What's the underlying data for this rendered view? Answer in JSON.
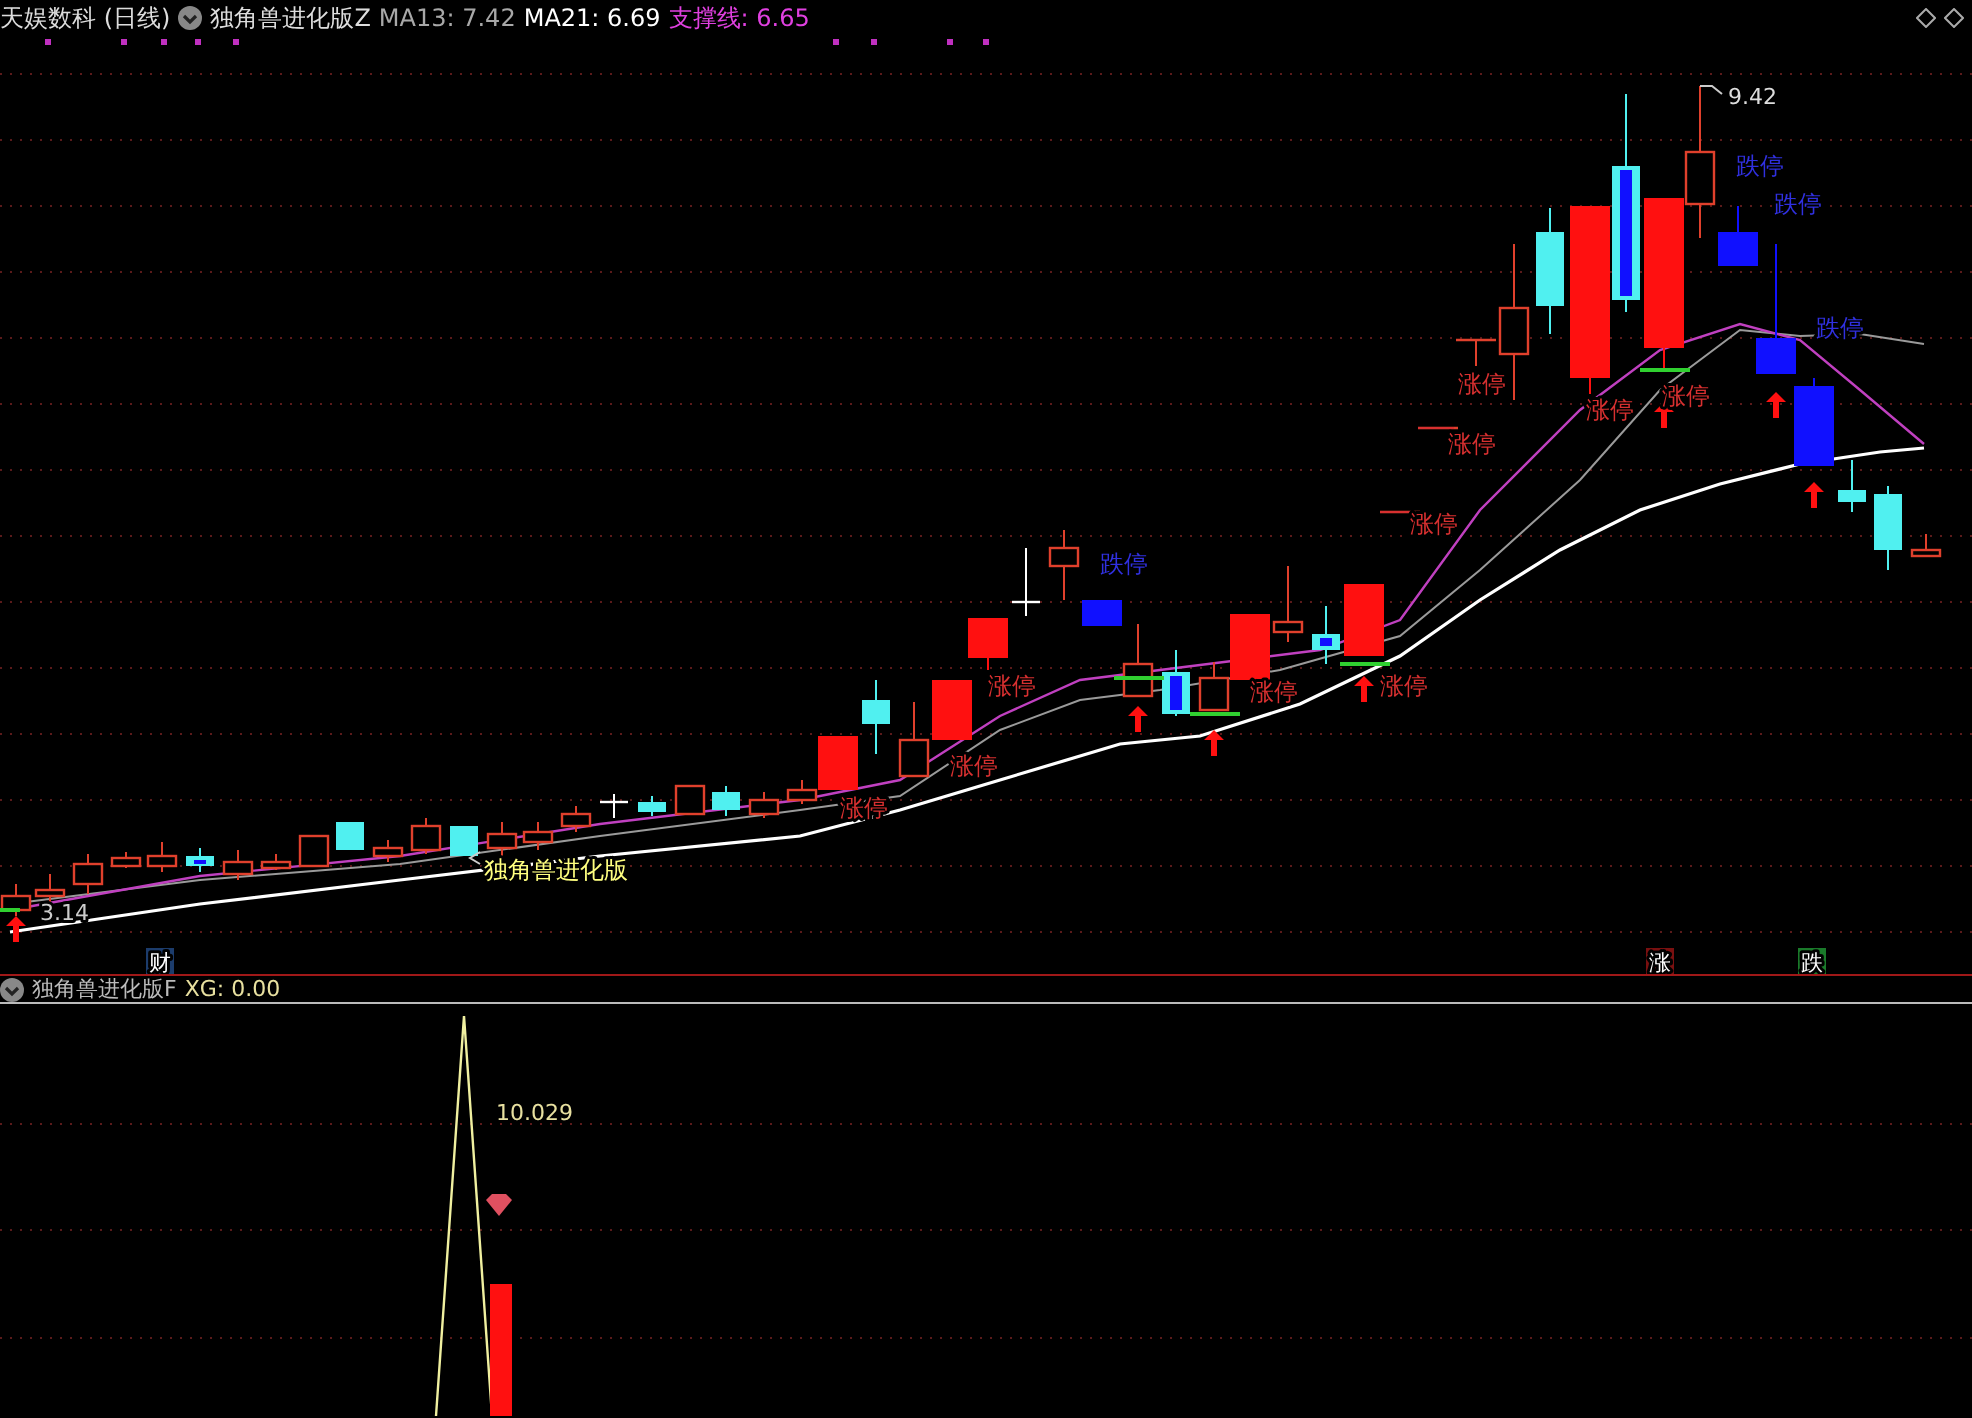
{
  "header": {
    "stock": "天娱数科 (日线)",
    "indicator": "独角兽进化版Z",
    "readings": [
      {
        "label": "MA13: 7.42",
        "color": "#a8a8a8"
      },
      {
        "label": "MA21: 6.69",
        "color": "#ffffff"
      },
      {
        "label": "支撑线: 6.65",
        "color": "#e040e0"
      }
    ]
  },
  "chart": {
    "high_label": "9.42",
    "low_label": "3.14",
    "indicator_label": "独角兽进化版",
    "signals": [
      {
        "kind": "limit-up",
        "text": "涨停"
      },
      {
        "kind": "limit-up",
        "text": "涨停"
      },
      {
        "kind": "limit-up",
        "text": "涨停"
      },
      {
        "kind": "limit-down",
        "text": "跌停"
      },
      {
        "kind": "limit-up",
        "text": "涨停"
      },
      {
        "kind": "limit-up",
        "text": "涨停"
      },
      {
        "kind": "limit-up",
        "text": "涨停"
      },
      {
        "kind": "limit-up",
        "text": "涨停"
      },
      {
        "kind": "limit-up",
        "text": "涨停"
      },
      {
        "kind": "limit-up",
        "text": "涨停"
      },
      {
        "kind": "limit-up",
        "text": "涨停"
      },
      {
        "kind": "limit-down",
        "text": "跌停"
      },
      {
        "kind": "limit-down",
        "text": "跌停"
      },
      {
        "kind": "limit-down",
        "text": "跌停"
      }
    ],
    "markers": [
      {
        "text": "财",
        "color": "#1c3c6c"
      },
      {
        "text": "涨",
        "color": "#7a1010"
      },
      {
        "text": "跌",
        "color": "#1a7a2a"
      }
    ]
  },
  "lower_panel": {
    "indicator": "独角兽进化版F",
    "reading": "XG: 0.00",
    "peak_label": "10.029"
  }
}
